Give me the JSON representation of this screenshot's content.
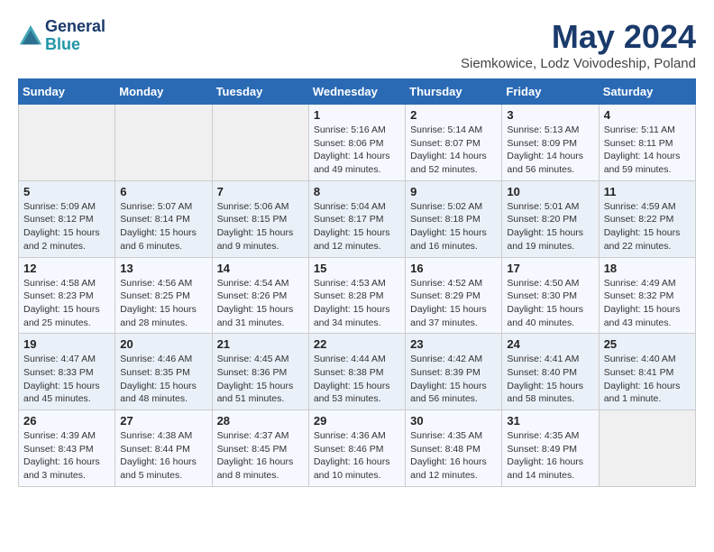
{
  "header": {
    "logo_line1": "General",
    "logo_line2": "Blue",
    "month_year": "May 2024",
    "location": "Siemkowice, Lodz Voivodeship, Poland"
  },
  "weekdays": [
    "Sunday",
    "Monday",
    "Tuesday",
    "Wednesday",
    "Thursday",
    "Friday",
    "Saturday"
  ],
  "weeks": [
    [
      {
        "day": "",
        "info": ""
      },
      {
        "day": "",
        "info": ""
      },
      {
        "day": "",
        "info": ""
      },
      {
        "day": "1",
        "info": "Sunrise: 5:16 AM\nSunset: 8:06 PM\nDaylight: 14 hours\nand 49 minutes."
      },
      {
        "day": "2",
        "info": "Sunrise: 5:14 AM\nSunset: 8:07 PM\nDaylight: 14 hours\nand 52 minutes."
      },
      {
        "day": "3",
        "info": "Sunrise: 5:13 AM\nSunset: 8:09 PM\nDaylight: 14 hours\nand 56 minutes."
      },
      {
        "day": "4",
        "info": "Sunrise: 5:11 AM\nSunset: 8:11 PM\nDaylight: 14 hours\nand 59 minutes."
      }
    ],
    [
      {
        "day": "5",
        "info": "Sunrise: 5:09 AM\nSunset: 8:12 PM\nDaylight: 15 hours\nand 2 minutes."
      },
      {
        "day": "6",
        "info": "Sunrise: 5:07 AM\nSunset: 8:14 PM\nDaylight: 15 hours\nand 6 minutes."
      },
      {
        "day": "7",
        "info": "Sunrise: 5:06 AM\nSunset: 8:15 PM\nDaylight: 15 hours\nand 9 minutes."
      },
      {
        "day": "8",
        "info": "Sunrise: 5:04 AM\nSunset: 8:17 PM\nDaylight: 15 hours\nand 12 minutes."
      },
      {
        "day": "9",
        "info": "Sunrise: 5:02 AM\nSunset: 8:18 PM\nDaylight: 15 hours\nand 16 minutes."
      },
      {
        "day": "10",
        "info": "Sunrise: 5:01 AM\nSunset: 8:20 PM\nDaylight: 15 hours\nand 19 minutes."
      },
      {
        "day": "11",
        "info": "Sunrise: 4:59 AM\nSunset: 8:22 PM\nDaylight: 15 hours\nand 22 minutes."
      }
    ],
    [
      {
        "day": "12",
        "info": "Sunrise: 4:58 AM\nSunset: 8:23 PM\nDaylight: 15 hours\nand 25 minutes."
      },
      {
        "day": "13",
        "info": "Sunrise: 4:56 AM\nSunset: 8:25 PM\nDaylight: 15 hours\nand 28 minutes."
      },
      {
        "day": "14",
        "info": "Sunrise: 4:54 AM\nSunset: 8:26 PM\nDaylight: 15 hours\nand 31 minutes."
      },
      {
        "day": "15",
        "info": "Sunrise: 4:53 AM\nSunset: 8:28 PM\nDaylight: 15 hours\nand 34 minutes."
      },
      {
        "day": "16",
        "info": "Sunrise: 4:52 AM\nSunset: 8:29 PM\nDaylight: 15 hours\nand 37 minutes."
      },
      {
        "day": "17",
        "info": "Sunrise: 4:50 AM\nSunset: 8:30 PM\nDaylight: 15 hours\nand 40 minutes."
      },
      {
        "day": "18",
        "info": "Sunrise: 4:49 AM\nSunset: 8:32 PM\nDaylight: 15 hours\nand 43 minutes."
      }
    ],
    [
      {
        "day": "19",
        "info": "Sunrise: 4:47 AM\nSunset: 8:33 PM\nDaylight: 15 hours\nand 45 minutes."
      },
      {
        "day": "20",
        "info": "Sunrise: 4:46 AM\nSunset: 8:35 PM\nDaylight: 15 hours\nand 48 minutes."
      },
      {
        "day": "21",
        "info": "Sunrise: 4:45 AM\nSunset: 8:36 PM\nDaylight: 15 hours\nand 51 minutes."
      },
      {
        "day": "22",
        "info": "Sunrise: 4:44 AM\nSunset: 8:38 PM\nDaylight: 15 hours\nand 53 minutes."
      },
      {
        "day": "23",
        "info": "Sunrise: 4:42 AM\nSunset: 8:39 PM\nDaylight: 15 hours\nand 56 minutes."
      },
      {
        "day": "24",
        "info": "Sunrise: 4:41 AM\nSunset: 8:40 PM\nDaylight: 15 hours\nand 58 minutes."
      },
      {
        "day": "25",
        "info": "Sunrise: 4:40 AM\nSunset: 8:41 PM\nDaylight: 16 hours\nand 1 minute."
      }
    ],
    [
      {
        "day": "26",
        "info": "Sunrise: 4:39 AM\nSunset: 8:43 PM\nDaylight: 16 hours\nand 3 minutes."
      },
      {
        "day": "27",
        "info": "Sunrise: 4:38 AM\nSunset: 8:44 PM\nDaylight: 16 hours\nand 5 minutes."
      },
      {
        "day": "28",
        "info": "Sunrise: 4:37 AM\nSunset: 8:45 PM\nDaylight: 16 hours\nand 8 minutes."
      },
      {
        "day": "29",
        "info": "Sunrise: 4:36 AM\nSunset: 8:46 PM\nDaylight: 16 hours\nand 10 minutes."
      },
      {
        "day": "30",
        "info": "Sunrise: 4:35 AM\nSunset: 8:48 PM\nDaylight: 16 hours\nand 12 minutes."
      },
      {
        "day": "31",
        "info": "Sunrise: 4:35 AM\nSunset: 8:49 PM\nDaylight: 16 hours\nand 14 minutes."
      },
      {
        "day": "",
        "info": ""
      }
    ]
  ]
}
